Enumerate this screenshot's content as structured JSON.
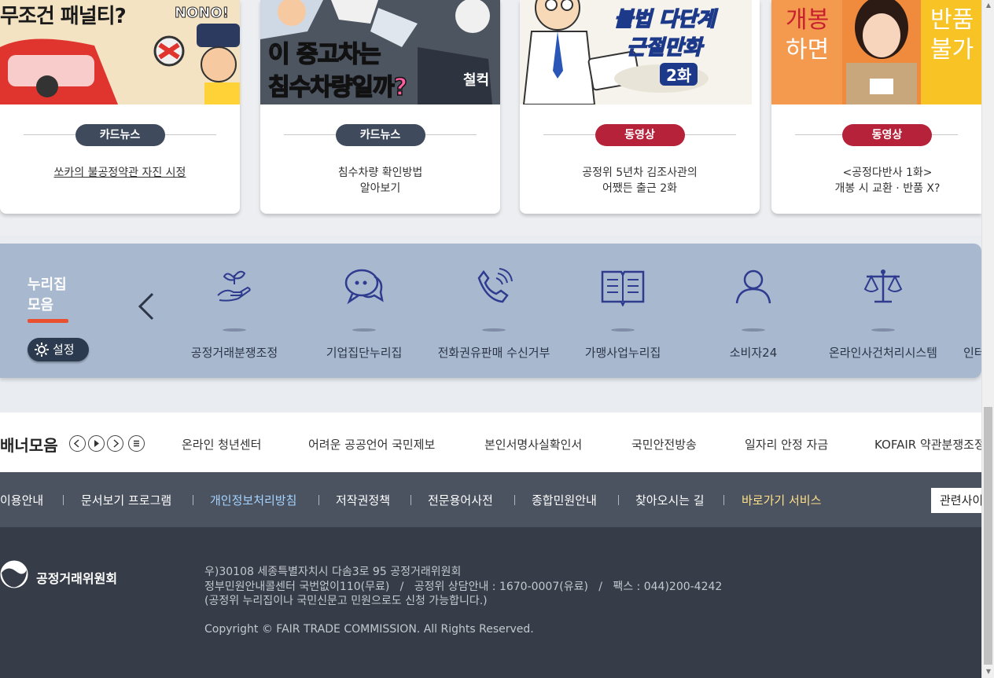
{
  "cards": [
    {
      "category": "카드뉴스",
      "category_type": "news",
      "title_lines": [
        "쏘카의 불공정약관 자진 시정"
      ],
      "underline": true,
      "thumb_text": [
        "무조건 패널티?",
        "NONO!"
      ]
    },
    {
      "category": "카드뉴스",
      "category_type": "news",
      "title_lines": [
        "침수차량 확인방법",
        "알아보기"
      ],
      "underline": false,
      "thumb_text": [
        "이 중고차는",
        "침수차량일까?",
        "철컥"
      ]
    },
    {
      "category": "동영상",
      "category_type": "video",
      "title_lines": [
        "공정위 5년차 김조사관의",
        "어쨌든 출근 2화"
      ],
      "underline": false,
      "thumb_text": [
        "불법 다단계",
        "근절만화",
        "2화"
      ]
    },
    {
      "category": "동영상",
      "category_type": "video",
      "title_lines": [
        "<공정다반사 1화>",
        "개봉 시 교환 · 반품 X?"
      ],
      "underline": false,
      "thumb_text": [
        "개봉",
        "하면",
        "반품",
        "불가"
      ]
    }
  ],
  "nuri": {
    "title_line1": "누리집",
    "title_line2": "모음",
    "setting_label": "설정",
    "items": [
      {
        "label": "공정거래분쟁조정",
        "icon": "hand-plant-icon"
      },
      {
        "label": "기업집단누리집",
        "icon": "chat-bubbles-icon"
      },
      {
        "label": "전화권유판매 수신거부",
        "icon": "phone-call-icon"
      },
      {
        "label": "가맹사업누리집",
        "icon": "open-book-icon"
      },
      {
        "label": "소비자24",
        "icon": "person-icon"
      },
      {
        "label": "온라인사건처리시스템",
        "icon": "scales-icon"
      },
      {
        "label": "인터",
        "icon": ""
      }
    ]
  },
  "banner": {
    "title": "배너모음",
    "items": [
      "온라인 청년센터",
      "어려운 공공언어 국민제보",
      "본인서명사실확인서",
      "국민안전방송",
      "일자리 안정 자금",
      "KOFAIR 약관분쟁조정"
    ]
  },
  "footer_nav": {
    "items": [
      "이용안내",
      "문서보기 프로그램",
      "개인정보처리방침",
      "저작권정책",
      "전문용어사전",
      "종합민원안내",
      "찾아오시는 길",
      "바로가기 서비스"
    ],
    "related": "관련사이트"
  },
  "footer": {
    "org_name": "공정거래위원회",
    "address": "우)30108 세종특별자치시 다솜3로 95 공정거래위원회",
    "contact": "정부민원안내콜센터 국번없이110(무료)   /   공정위 상담안내 : 1670-0007(유료)   /   팩스 : 044)200-4242",
    "note": "(공정위 누리집이나 국민신문고 민원으로도 신청 가능합니다.)",
    "copyright": "Copyright © FAIR TRADE COMMISSION. All Rights Reserved."
  },
  "colors": {
    "news": "#3f4a5c",
    "video": "#b5223a",
    "nuri_bg": "#a8b8cf",
    "footer_bg": "#373d48"
  }
}
